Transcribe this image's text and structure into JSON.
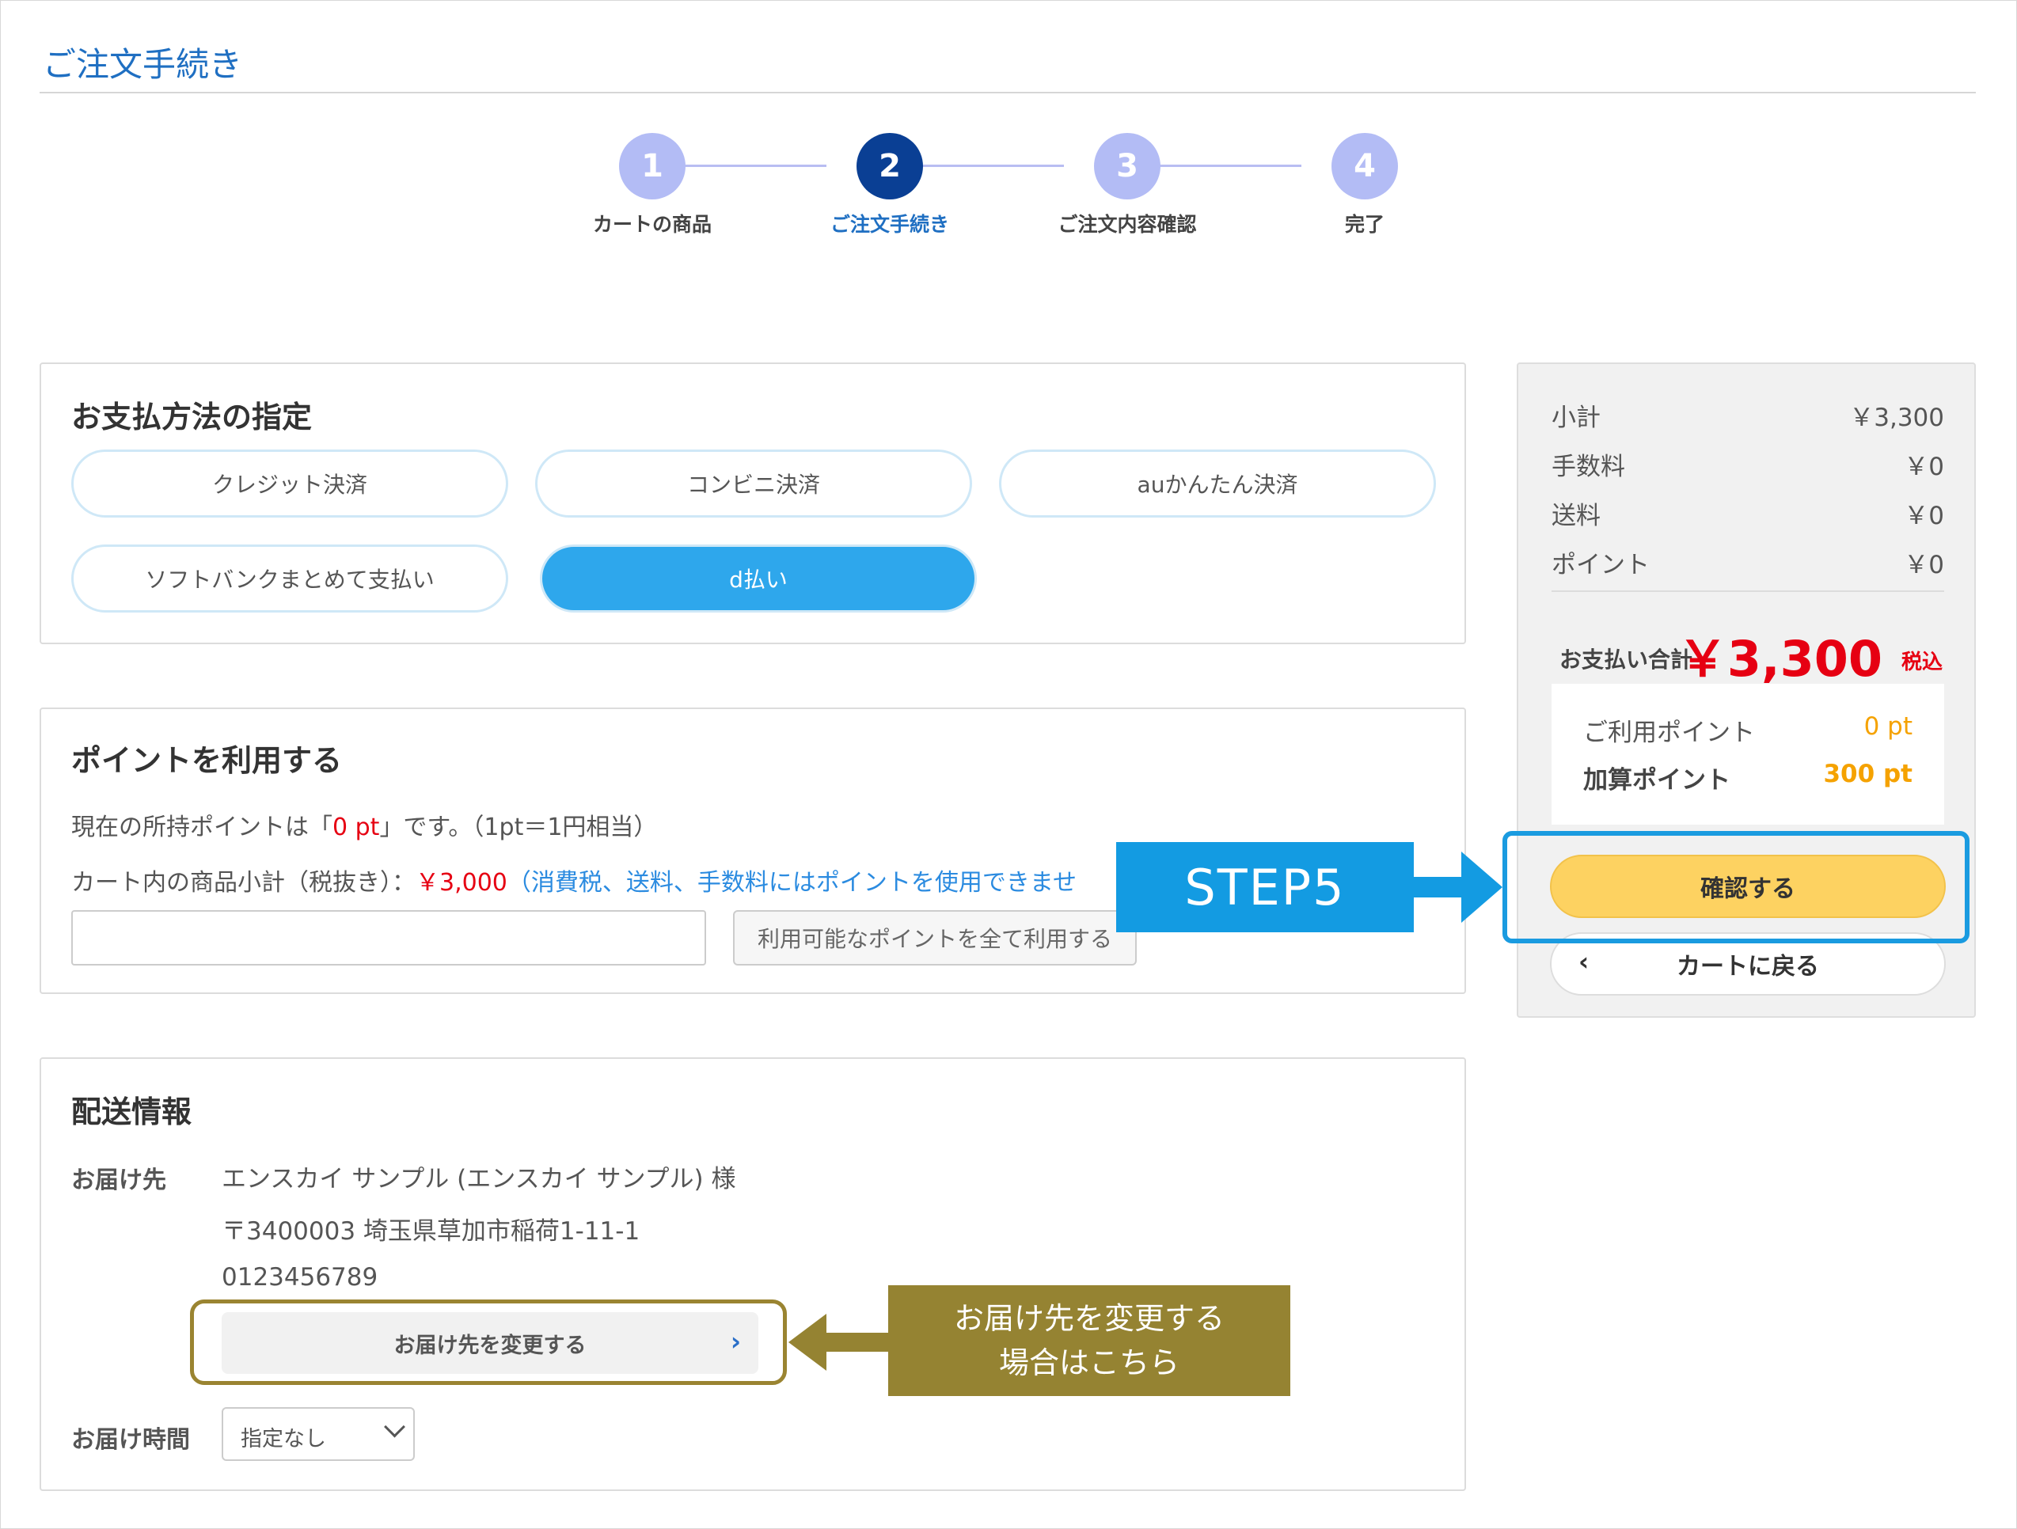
{
  "page": {
    "title": "ご注文手続き"
  },
  "stepper": {
    "steps": [
      {
        "number": "1",
        "label": "カートの商品"
      },
      {
        "number": "2",
        "label": "ご注文手続き"
      },
      {
        "number": "3",
        "label": "ご注文内容確認"
      },
      {
        "number": "4",
        "label": "完了"
      }
    ],
    "active_step": 2
  },
  "payment": {
    "title": "お支払方法の指定",
    "options": [
      "クレジット決済",
      "コンビニ決済",
      "auかんたん決済",
      "ソフトバンクまとめて支払い",
      "d払い"
    ],
    "selected": "d払い"
  },
  "points": {
    "title": "ポイントを利用する",
    "owned_prefix": "現在の所持ポイントは「",
    "owned_value": "0 pt",
    "owned_suffix": "」です。（1pt＝1円相当）",
    "subtotal_prefix": "カート内の商品小計（税抜き）：",
    "subtotal_value": "￥3,000",
    "subtotal_note": "（消費税、送料、手数料にはポイントを使用できませ",
    "input_value": "",
    "use_all_label": "利用可能なポイントを全て利用する"
  },
  "shipping": {
    "title": "配送情報",
    "dest_label": "お届け先",
    "name": "エンスカイ サンプル (エンスカイ サンプル) 様",
    "address": "〒3400003 埼玉県草加市稲荷1-11-1",
    "phone": "0123456789",
    "change_label": "お届け先を変更する",
    "time_label": "お届け時間",
    "time_value": "指定なし"
  },
  "summary": {
    "rows": [
      {
        "label": "小計",
        "value": "￥3,300"
      },
      {
        "label": "手数料",
        "value": "￥0"
      },
      {
        "label": "送料",
        "value": "￥0"
      },
      {
        "label": "ポイント",
        "value": "￥0"
      }
    ],
    "total_label": "お支払い合計",
    "total_value": "￥3,300",
    "total_tax": "税込",
    "used_points_label": "ご利用ポイント",
    "used_points_value": "0 pt",
    "added_points_label": "加算ポイント",
    "added_points_value": "300 pt",
    "confirm_label": "確認する",
    "back_label": "カートに戻る"
  },
  "annotations": {
    "step5": "STEP5",
    "change_dest_line1": "お届け先を変更する",
    "change_dest_line2": "場合はこちら"
  },
  "colors": {
    "accent_blue": "#2ea7ec",
    "brand_navy": "#0a3f94",
    "price_red": "#e60012",
    "points_orange": "#f5a200",
    "confirm_yellow": "#fdd261",
    "annotation_olive": "#958332",
    "annotation_blue": "#139be2"
  }
}
